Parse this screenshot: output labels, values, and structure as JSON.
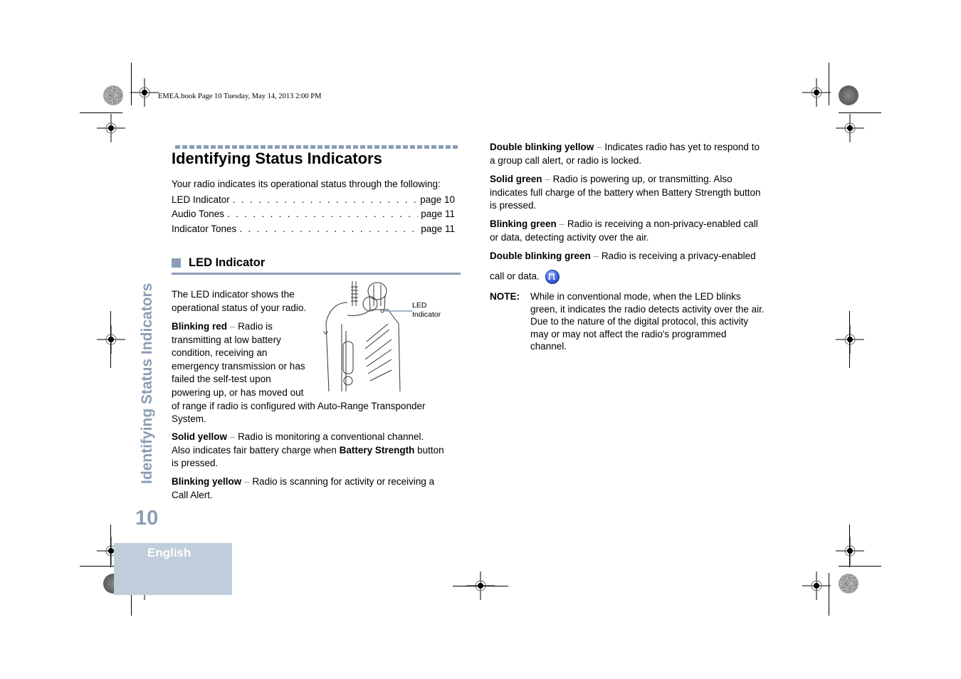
{
  "print_slug": "EMEA.book  Page 10  Tuesday, May 14, 2013  2:00 PM",
  "page": {
    "title": "Identifying Status Indicators",
    "intro": "Your radio indicates its operational status through the following:",
    "toc": [
      {
        "label": "LED Indicator",
        "dots": ". . . . . . . . . . . . . . . . . . . . . . . . . . . . . . . . .",
        "page": "page 10"
      },
      {
        "label": "Audio Tones",
        "dots": ". . . . . . . . . . . . . . . . . . . . . . . . . . . . . . . . . .",
        "page": "page 11"
      },
      {
        "label": "Indicator Tones",
        "dots": ". . . . . . . . . . . . . . . . . . . . . . . . . . . . . . .",
        "page": "page 11"
      }
    ],
    "section": {
      "heading": "LED Indicator",
      "lead": [
        "The LED indicator shows the",
        "operational status of your radio."
      ],
      "figure_label": [
        "LED",
        "Indicator"
      ],
      "dash": "–",
      "items": [
        {
          "term": "Blinking red",
          "lines": [
            "Radio is",
            "transmitting at low battery",
            "condition, receiving an",
            "emergency transmission or has",
            "failed the self-test upon",
            "powering up, or has moved out",
            "of range if radio is configured with Auto-Range Transponder",
            "System."
          ]
        },
        {
          "term": "Solid yellow",
          "text1": "Radio is monitoring a conventional channel.",
          "text2": "Also indicates fair battery charge when ",
          "bold": "Battery Strength",
          "text3": " button",
          "text4": "is pressed."
        },
        {
          "term": "Blinking yellow",
          "text1": "Radio is scanning for activity or receiving a",
          "text2": "Call Alert."
        },
        {
          "term": "Double blinking yellow",
          "text1": "Indicates radio has yet to respond to",
          "text2": "a group call alert, or radio is locked."
        },
        {
          "term": "Solid green",
          "text1": "Radio is powering up, or transmitting. Also",
          "text2": "indicates full charge of the battery when Battery Strength button",
          "text3": "is pressed."
        },
        {
          "term": "Blinking green",
          "text1": "Radio is receiving a non-privacy-enabled call",
          "text2": "or data, detecting activity over the air."
        },
        {
          "term": "Double blinking green",
          "text1": "Radio is receiving a privacy-enabled",
          "text2": "call or data.",
          "icon": "digital-signal-icon"
        }
      ],
      "note": {
        "label": "NOTE:",
        "lines": [
          "While in conventional mode, when the LED blinks",
          "green, it indicates the radio detects activity over the air.",
          "Due to the nature of the digital protocol, this activity",
          "may or may not affect the radio's programmed",
          "channel."
        ]
      }
    }
  },
  "sidebar": {
    "chapter_title": "Identifying Status Indicators",
    "page_number": "10",
    "language": "English"
  },
  "colors": {
    "accent": "#8a9db5",
    "language_box": "#c0cddb"
  }
}
